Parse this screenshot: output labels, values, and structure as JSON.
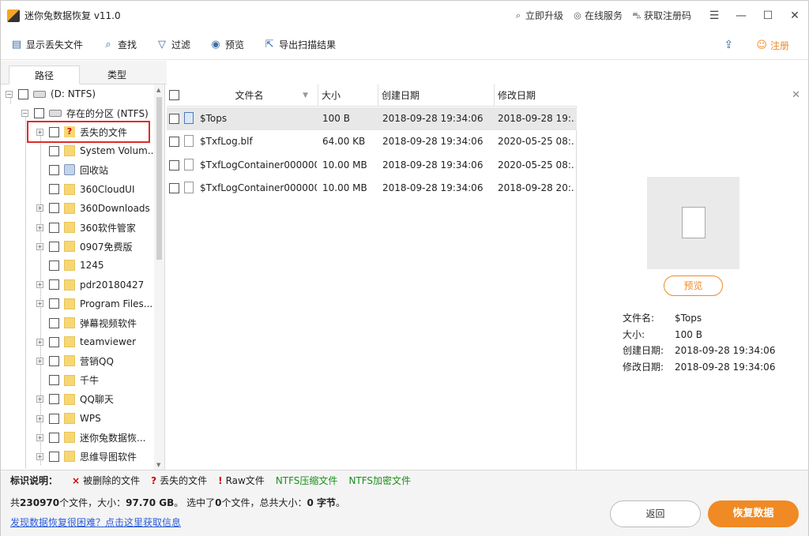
{
  "window": {
    "title": "迷你兔数据恢复 v11.0",
    "links": [
      {
        "icon": "search-icon",
        "label": "立即升级"
      },
      {
        "icon": "headset-icon",
        "label": "在线服务"
      },
      {
        "icon": "cart-icon",
        "label": "获取注册码"
      }
    ]
  },
  "toolbar": {
    "items": [
      {
        "icon": "show-lost-files-icon",
        "label": "显示丢失文件"
      },
      {
        "icon": "search-icon",
        "label": "查找"
      },
      {
        "icon": "filter-icon",
        "label": "过滤"
      },
      {
        "icon": "eye-icon",
        "label": "预览"
      },
      {
        "icon": "export-icon",
        "label": "导出扫描结果"
      }
    ],
    "register_label": "注册"
  },
  "tabs": [
    "路径",
    "类型"
  ],
  "tree": {
    "root": "(D: NTFS)",
    "partition": "存在的分区 (NTFS)",
    "folders": [
      {
        "label": "丢失的文件",
        "expandable": true,
        "kind": "lost"
      },
      {
        "label": "System Volum...",
        "expandable": false,
        "kind": "folder"
      },
      {
        "label": "回收站",
        "expandable": false,
        "kind": "bin"
      },
      {
        "label": "360CloudUI",
        "expandable": false,
        "kind": "folder"
      },
      {
        "label": "360Downloads",
        "expandable": true,
        "kind": "folder"
      },
      {
        "label": "360软件管家",
        "expandable": true,
        "kind": "folder"
      },
      {
        "label": "0907免费版",
        "expandable": true,
        "kind": "folder"
      },
      {
        "label": "1245",
        "expandable": false,
        "kind": "folder"
      },
      {
        "label": "pdr20180427",
        "expandable": true,
        "kind": "folder"
      },
      {
        "label": "Program Files...",
        "expandable": true,
        "kind": "folder"
      },
      {
        "label": "弹幕视频软件",
        "expandable": false,
        "kind": "folder"
      },
      {
        "label": "teamviewer",
        "expandable": true,
        "kind": "folder"
      },
      {
        "label": "营销QQ",
        "expandable": true,
        "kind": "folder"
      },
      {
        "label": "千牛",
        "expandable": false,
        "kind": "folder"
      },
      {
        "label": "QQ聊天",
        "expandable": true,
        "kind": "folder"
      },
      {
        "label": "WPS",
        "expandable": true,
        "kind": "folder"
      },
      {
        "label": "迷你兔数据恢...",
        "expandable": true,
        "kind": "folder"
      },
      {
        "label": "思维导图软件",
        "expandable": true,
        "kind": "folder"
      }
    ]
  },
  "files": {
    "headers": [
      "文件名",
      "大小",
      "创建日期",
      "修改日期"
    ],
    "rows": [
      {
        "name": "$Tops",
        "size": "100 B",
        "created": "2018-09-28 19:34:06",
        "modified": "2018-09-28 19:...",
        "selected": true
      },
      {
        "name": "$TxfLog.blf",
        "size": "64.00 KB",
        "created": "2018-09-28 19:34:06",
        "modified": "2020-05-25 08:...",
        "selected": false
      },
      {
        "name": "$TxfLogContainer000000...",
        "size": "10.00 MB",
        "created": "2018-09-28 19:34:06",
        "modified": "2020-05-25 08:...",
        "selected": false
      },
      {
        "name": "$TxfLogContainer000000...",
        "size": "10.00 MB",
        "created": "2018-09-28 19:34:06",
        "modified": "2018-09-28 20:...",
        "selected": false
      }
    ]
  },
  "preview": {
    "button_label": "预览",
    "info": [
      {
        "key": "文件名:",
        "value": "$Tops"
      },
      {
        "key": "大小:",
        "value": "100 B"
      },
      {
        "key": "创建日期:",
        "value": "2018-09-28 19:34:06"
      },
      {
        "key": "修改日期:",
        "value": "2018-09-28 19:34:06"
      }
    ]
  },
  "legend": {
    "label": "标识说明：",
    "items": [
      {
        "mark": "×",
        "text": "被删除的文件",
        "color": "#d40000"
      },
      {
        "mark": "?",
        "text": "丢失的文件",
        "color": "#d40000"
      },
      {
        "mark": "!",
        "text": "Raw文件",
        "color": "#d40000"
      },
      {
        "mark": "",
        "text": "NTFS压缩文件",
        "color": "#1a8f1a"
      },
      {
        "mark": "",
        "text": "NTFS加密文件",
        "color": "#1a8f1a"
      }
    ]
  },
  "status": {
    "p1": "共",
    "count": "230970",
    "p2": "个文件，大小：",
    "size": "97.70 GB",
    "p3": "。 选中了",
    "sel_count": "0",
    "p4": "个文件，总共大小：",
    "sel_size": "0 字节",
    "p5": "。",
    "help_link": "发现数据恢复很困难？点击这里获取信息",
    "back_label": "返回",
    "recover_label": "恢复数据"
  }
}
